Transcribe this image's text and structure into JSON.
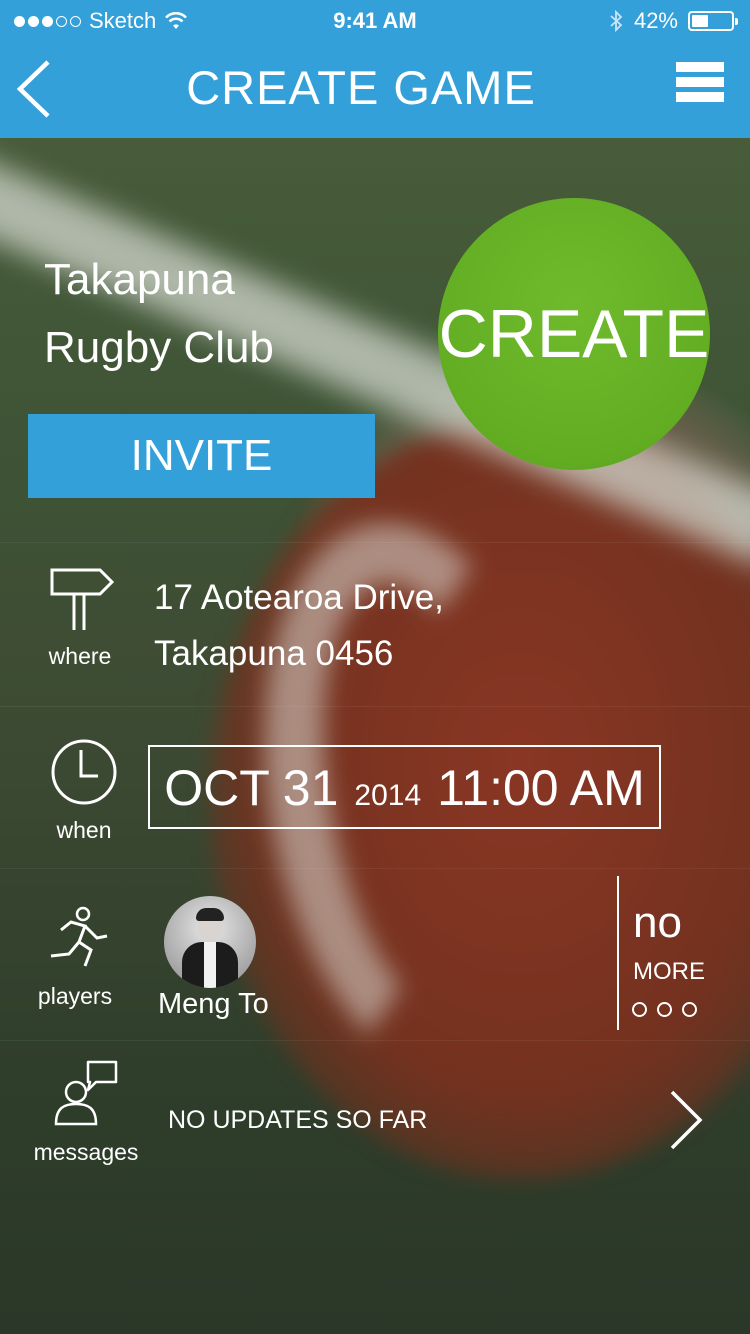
{
  "status_bar": {
    "carrier": "Sketch",
    "time": "9:41 AM",
    "battery": "42%",
    "battery_level": 0.42,
    "signal_bars_filled": 3,
    "signal_bars_total": 5
  },
  "nav": {
    "title": "CREATE GAME",
    "back_icon": "chevron-left-icon",
    "menu_icon": "hamburger-menu-icon"
  },
  "club": {
    "line1": "Takapuna",
    "line2": "Rugby Club"
  },
  "actions": {
    "create_label": "CREATE",
    "invite_label": "INVITE"
  },
  "where": {
    "caption": "where",
    "icon": "signpost-icon",
    "address_line1": "17 Aotearoa Drive,",
    "address_line2": "Takapuna 0456"
  },
  "when": {
    "caption": "when",
    "icon": "clock-icon",
    "date": "OCT 31",
    "year": "2014",
    "time": "11:00 AM"
  },
  "players": {
    "caption": "players",
    "icon": "running-person-icon",
    "list": [
      {
        "name": "Meng To"
      }
    ],
    "more_count": "no",
    "more_label": "MORE"
  },
  "messages": {
    "caption": "messages",
    "icon": "chat-person-icon",
    "status": "NO UPDATES SO FAR"
  },
  "colors": {
    "accent_blue": "#34a0d9",
    "create_green": "#62ad22"
  }
}
